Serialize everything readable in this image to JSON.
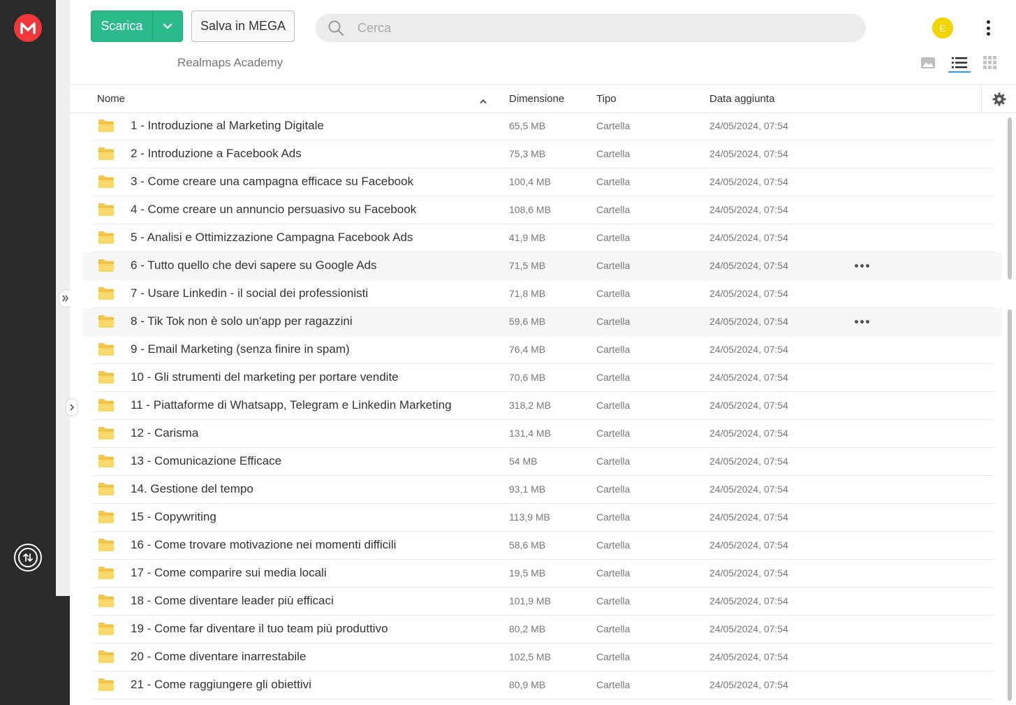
{
  "toolbar": {
    "download_label": "Scarica",
    "save_label": "Salva in MEGA",
    "search_placeholder": "Cerca",
    "avatar_initial": "E"
  },
  "breadcrumb": "Realmaps Academy",
  "columns": {
    "name": "Nome",
    "size": "Dimensione",
    "type": "Tipo",
    "date": "Data aggiunta"
  },
  "rows": [
    {
      "name": "1 - Introduzione al Marketing Digitale",
      "size": "65,5 MB",
      "type": "Cartella",
      "date": "24/05/2024, 07:54"
    },
    {
      "name": "2 - Introduzione a Facebook Ads",
      "size": "75,3 MB",
      "type": "Cartella",
      "date": "24/05/2024, 07:54"
    },
    {
      "name": "3 - Come creare una campagna efficace su Facebook",
      "size": "100,4 MB",
      "type": "Cartella",
      "date": "24/05/2024, 07:54"
    },
    {
      "name": "4 - Come creare un annuncio persuasivo su Facebook",
      "size": "108,6 MB",
      "type": "Cartella",
      "date": "24/05/2024, 07:54"
    },
    {
      "name": "5 - Analisi e Ottimizzazione Campagna Facebook Ads",
      "size": "41,9 MB",
      "type": "Cartella",
      "date": "24/05/2024, 07:54"
    },
    {
      "name": "6 - Tutto quello che devi sapere su Google Ads",
      "size": "71,5 MB",
      "type": "Cartella",
      "date": "24/05/2024, 07:54"
    },
    {
      "name": "7 - Usare Linkedin - il social dei professionisti",
      "size": "71,8 MB",
      "type": "Cartella",
      "date": "24/05/2024, 07:54"
    },
    {
      "name": "8 - Tik Tok non è solo un'app per ragazzini",
      "size": "59,6 MB",
      "type": "Cartella",
      "date": "24/05/2024, 07:54"
    },
    {
      "name": "9 - Email Marketing (senza finire in spam)",
      "size": "76,4 MB",
      "type": "Cartella",
      "date": "24/05/2024, 07:54"
    },
    {
      "name": "10 - Gli strumenti del marketing per portare vendite",
      "size": "70,6 MB",
      "type": "Cartella",
      "date": "24/05/2024, 07:54"
    },
    {
      "name": "11 - Piattaforme di Whatsapp, Telegram e Linkedin Marketing",
      "size": "318,2 MB",
      "type": "Cartella",
      "date": "24/05/2024, 07:54"
    },
    {
      "name": "12 - Carisma",
      "size": "131,4 MB",
      "type": "Cartella",
      "date": "24/05/2024, 07:54"
    },
    {
      "name": "13 - Comunicazione Efficace",
      "size": "54 MB",
      "type": "Cartella",
      "date": "24/05/2024, 07:54"
    },
    {
      "name": "14. Gestione del tempo",
      "size": "93,1 MB",
      "type": "Cartella",
      "date": "24/05/2024, 07:54"
    },
    {
      "name": "15 - Copywriting",
      "size": "113,9 MB",
      "type": "Cartella",
      "date": "24/05/2024, 07:54"
    },
    {
      "name": "16 - Come trovare motivazione nei momenti difficili",
      "size": "58,6 MB",
      "type": "Cartella",
      "date": "24/05/2024, 07:54"
    },
    {
      "name": "17 - Come comparire sui media locali",
      "size": "19,5 MB",
      "type": "Cartella",
      "date": "24/05/2024, 07:54"
    },
    {
      "name": "18 - Come diventare leader più efficaci",
      "size": "101,9 MB",
      "type": "Cartella",
      "date": "24/05/2024, 07:54"
    },
    {
      "name": "19 - Come far diventare il tuo team più produttivo",
      "size": "80,2 MB",
      "type": "Cartella",
      "date": "24/05/2024, 07:54"
    },
    {
      "name": "20 - Come diventare inarrestabile",
      "size": "102,5 MB",
      "type": "Cartella",
      "date": "24/05/2024, 07:54"
    },
    {
      "name": "21 - Come raggiungere gli obiettivi",
      "size": "80,9 MB",
      "type": "Cartella",
      "date": "24/05/2024, 07:54"
    }
  ],
  "colors": {
    "brand_red": "#f0373a",
    "download_green": "#2bba8b",
    "avatar_yellow": "#f3d500",
    "active_view_blue": "#2b9be8",
    "folder_yellow": "#f7d46b"
  },
  "icons": {
    "logo": "mega-logo-icon",
    "transfers": "transfers-icon",
    "search": "search-icon",
    "settings": "gear-icon",
    "folder": "folder-icon"
  }
}
